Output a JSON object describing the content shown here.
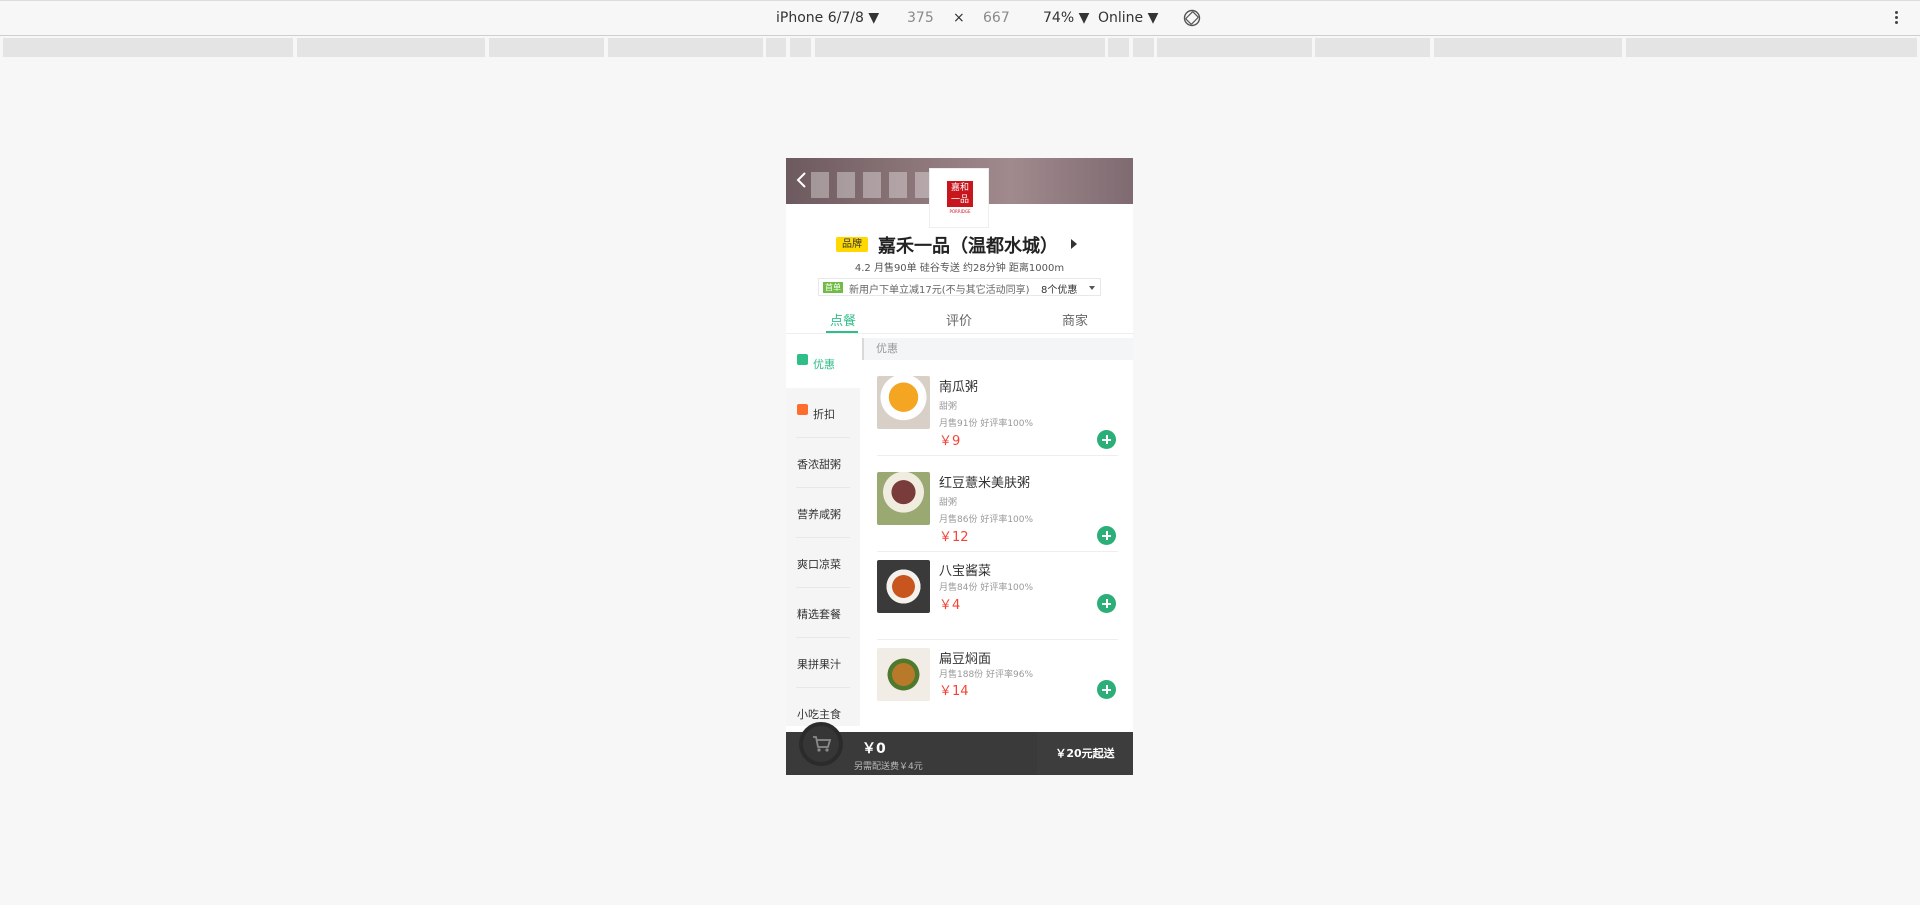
{
  "devtools": {
    "device": "iPhone 6/7/8 ▼",
    "width": "375",
    "times": "×",
    "height": "667",
    "zoom": "74% ▼",
    "network": "Online ▼"
  },
  "shop": {
    "logo_text": "嘉和\n一品",
    "logo_sub": "PORRIDGE",
    "brand_tag": "品牌",
    "name": "嘉禾一品（温都水城）",
    "meta": "4.2   月售90单   硅谷专送 约28分钟   距离1000m",
    "promo_tag": "首单",
    "promo_text": "新用户下单立减17元(不与其它活动同享)",
    "promo_count": "8个优惠"
  },
  "tabs": [
    "点餐",
    "评价",
    "商家"
  ],
  "sidebar": [
    {
      "label": "优惠",
      "icon": "discount-icon",
      "color": "#2fbd88"
    },
    {
      "label": "折扣",
      "icon": "sale-icon",
      "color": "#ff6d2e"
    },
    {
      "label": "香浓甜粥"
    },
    {
      "label": "营养咸粥"
    },
    {
      "label": "爽口凉菜"
    },
    {
      "label": "精选套餐"
    },
    {
      "label": "果拼果汁"
    },
    {
      "label": "小吃主食"
    }
  ],
  "section_title": "优惠",
  "foods": [
    {
      "name": "南瓜粥",
      "desc": "甜粥",
      "stats": "月售91份     好评率100%",
      "price": "￥9"
    },
    {
      "name": "红豆薏米美肤粥",
      "desc": "甜粥",
      "stats": "月售86份     好评率100%",
      "price": "￥12"
    },
    {
      "name": "八宝酱菜",
      "desc": "",
      "stats": "月售84份     好评率100%",
      "price": "￥4"
    },
    {
      "name": "扁豆焖面",
      "desc": "",
      "stats": "月售188份     好评率96%",
      "price": "￥14"
    }
  ],
  "cart": {
    "total": "￥0",
    "delivery_note": "另需配送费￥4元",
    "min_order": "￥20元起送"
  }
}
